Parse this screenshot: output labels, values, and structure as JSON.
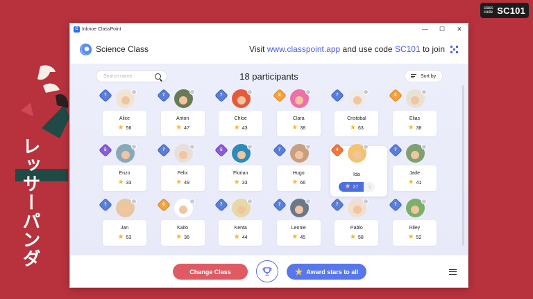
{
  "background": {
    "vertical_text": "レッサーパンダ",
    "code_badge": {
      "small_label": "class code",
      "code": "SC101"
    },
    "colors": {
      "background": "#b7323d",
      "accent": "#4a5ee6",
      "change_class": "#e05a64",
      "award": "#5877ea"
    }
  },
  "window": {
    "title": "Inknoe ClassPoint",
    "controls": {
      "minimize": "—",
      "maximize": "☐",
      "close": "✕"
    }
  },
  "header": {
    "class_name": "Science Class",
    "join_prefix": "Visit ",
    "join_url": "www.classpoint.app",
    "join_middle": " and use code ",
    "join_code": "SC101",
    "join_suffix": " to join",
    "qr_icon": "qr-code-icon"
  },
  "main": {
    "search_placeholder": "Search name",
    "participants_title": "18 participants",
    "sort_label": "Sort by"
  },
  "participants": [
    {
      "name": "Alice",
      "stars": "56",
      "level": "7",
      "badge_color": "blue"
    },
    {
      "name": "Anton",
      "stars": "47",
      "level": "7",
      "badge_color": "blue"
    },
    {
      "name": "Chloe",
      "stars": "43",
      "level": "7",
      "badge_color": "blue"
    },
    {
      "name": "Clara",
      "stars": "38",
      "level": "8",
      "badge_color": "orange"
    },
    {
      "name": "Cristobal",
      "stars": "63",
      "level": "7",
      "badge_color": "blue"
    },
    {
      "name": "Elias",
      "stars": "38",
      "level": "8",
      "badge_color": "orange"
    },
    {
      "name": "Enzo",
      "stars": "33",
      "level": "5",
      "badge_color": "purple"
    },
    {
      "name": "Felix",
      "stars": "49",
      "level": "7",
      "badge_color": "blue"
    },
    {
      "name": "Florian",
      "stars": "33",
      "level": "5",
      "badge_color": "purple"
    },
    {
      "name": "Hugo",
      "stars": "66",
      "level": "7",
      "badge_color": "blue"
    },
    {
      "name": "Ida",
      "stars": "27",
      "level": "4",
      "badge_color": "red",
      "selected": true
    },
    {
      "name": "Jade",
      "stars": "41",
      "level": "7",
      "badge_color": "blue"
    },
    {
      "name": "Jan",
      "stars": "53",
      "level": "7",
      "badge_color": "blue"
    },
    {
      "name": "Kaito",
      "stars": "36",
      "level": "6",
      "badge_color": "orange"
    },
    {
      "name": "Kenta",
      "stars": "44",
      "level": "7",
      "badge_color": "blue"
    },
    {
      "name": "Leonie",
      "stars": "45",
      "level": "7",
      "badge_color": "blue"
    },
    {
      "name": "Pablo",
      "stars": "58",
      "level": "7",
      "badge_color": "blue"
    },
    {
      "name": "Riley",
      "stars": "52",
      "level": "7",
      "badge_color": "blue"
    }
  ],
  "footer": {
    "change_class_label": "Change Class",
    "award_label": "Award stars to all",
    "trophy_icon": "trophy-icon",
    "menu_icon": "hamburger-menu-icon"
  }
}
